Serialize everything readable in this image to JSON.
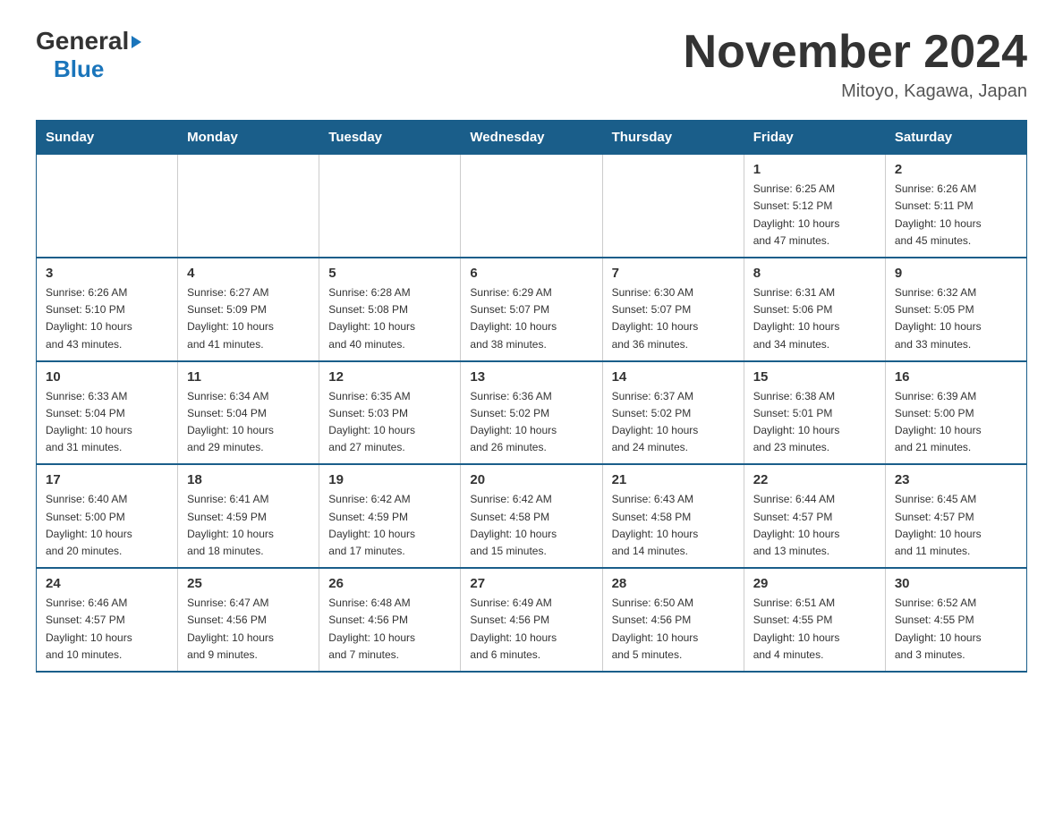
{
  "header": {
    "month_title": "November 2024",
    "location": "Mitoyo, Kagawa, Japan",
    "logo_general": "General",
    "logo_blue": "Blue"
  },
  "days_of_week": [
    "Sunday",
    "Monday",
    "Tuesday",
    "Wednesday",
    "Thursday",
    "Friday",
    "Saturday"
  ],
  "weeks": [
    {
      "cells": [
        {
          "day": "",
          "info": ""
        },
        {
          "day": "",
          "info": ""
        },
        {
          "day": "",
          "info": ""
        },
        {
          "day": "",
          "info": ""
        },
        {
          "day": "",
          "info": ""
        },
        {
          "day": "1",
          "info": "Sunrise: 6:25 AM\nSunset: 5:12 PM\nDaylight: 10 hours\nand 47 minutes."
        },
        {
          "day": "2",
          "info": "Sunrise: 6:26 AM\nSunset: 5:11 PM\nDaylight: 10 hours\nand 45 minutes."
        }
      ]
    },
    {
      "cells": [
        {
          "day": "3",
          "info": "Sunrise: 6:26 AM\nSunset: 5:10 PM\nDaylight: 10 hours\nand 43 minutes."
        },
        {
          "day": "4",
          "info": "Sunrise: 6:27 AM\nSunset: 5:09 PM\nDaylight: 10 hours\nand 41 minutes."
        },
        {
          "day": "5",
          "info": "Sunrise: 6:28 AM\nSunset: 5:08 PM\nDaylight: 10 hours\nand 40 minutes."
        },
        {
          "day": "6",
          "info": "Sunrise: 6:29 AM\nSunset: 5:07 PM\nDaylight: 10 hours\nand 38 minutes."
        },
        {
          "day": "7",
          "info": "Sunrise: 6:30 AM\nSunset: 5:07 PM\nDaylight: 10 hours\nand 36 minutes."
        },
        {
          "day": "8",
          "info": "Sunrise: 6:31 AM\nSunset: 5:06 PM\nDaylight: 10 hours\nand 34 minutes."
        },
        {
          "day": "9",
          "info": "Sunrise: 6:32 AM\nSunset: 5:05 PM\nDaylight: 10 hours\nand 33 minutes."
        }
      ]
    },
    {
      "cells": [
        {
          "day": "10",
          "info": "Sunrise: 6:33 AM\nSunset: 5:04 PM\nDaylight: 10 hours\nand 31 minutes."
        },
        {
          "day": "11",
          "info": "Sunrise: 6:34 AM\nSunset: 5:04 PM\nDaylight: 10 hours\nand 29 minutes."
        },
        {
          "day": "12",
          "info": "Sunrise: 6:35 AM\nSunset: 5:03 PM\nDaylight: 10 hours\nand 27 minutes."
        },
        {
          "day": "13",
          "info": "Sunrise: 6:36 AM\nSunset: 5:02 PM\nDaylight: 10 hours\nand 26 minutes."
        },
        {
          "day": "14",
          "info": "Sunrise: 6:37 AM\nSunset: 5:02 PM\nDaylight: 10 hours\nand 24 minutes."
        },
        {
          "day": "15",
          "info": "Sunrise: 6:38 AM\nSunset: 5:01 PM\nDaylight: 10 hours\nand 23 minutes."
        },
        {
          "day": "16",
          "info": "Sunrise: 6:39 AM\nSunset: 5:00 PM\nDaylight: 10 hours\nand 21 minutes."
        }
      ]
    },
    {
      "cells": [
        {
          "day": "17",
          "info": "Sunrise: 6:40 AM\nSunset: 5:00 PM\nDaylight: 10 hours\nand 20 minutes."
        },
        {
          "day": "18",
          "info": "Sunrise: 6:41 AM\nSunset: 4:59 PM\nDaylight: 10 hours\nand 18 minutes."
        },
        {
          "day": "19",
          "info": "Sunrise: 6:42 AM\nSunset: 4:59 PM\nDaylight: 10 hours\nand 17 minutes."
        },
        {
          "day": "20",
          "info": "Sunrise: 6:42 AM\nSunset: 4:58 PM\nDaylight: 10 hours\nand 15 minutes."
        },
        {
          "day": "21",
          "info": "Sunrise: 6:43 AM\nSunset: 4:58 PM\nDaylight: 10 hours\nand 14 minutes."
        },
        {
          "day": "22",
          "info": "Sunrise: 6:44 AM\nSunset: 4:57 PM\nDaylight: 10 hours\nand 13 minutes."
        },
        {
          "day": "23",
          "info": "Sunrise: 6:45 AM\nSunset: 4:57 PM\nDaylight: 10 hours\nand 11 minutes."
        }
      ]
    },
    {
      "cells": [
        {
          "day": "24",
          "info": "Sunrise: 6:46 AM\nSunset: 4:57 PM\nDaylight: 10 hours\nand 10 minutes."
        },
        {
          "day": "25",
          "info": "Sunrise: 6:47 AM\nSunset: 4:56 PM\nDaylight: 10 hours\nand 9 minutes."
        },
        {
          "day": "26",
          "info": "Sunrise: 6:48 AM\nSunset: 4:56 PM\nDaylight: 10 hours\nand 7 minutes."
        },
        {
          "day": "27",
          "info": "Sunrise: 6:49 AM\nSunset: 4:56 PM\nDaylight: 10 hours\nand 6 minutes."
        },
        {
          "day": "28",
          "info": "Sunrise: 6:50 AM\nSunset: 4:56 PM\nDaylight: 10 hours\nand 5 minutes."
        },
        {
          "day": "29",
          "info": "Sunrise: 6:51 AM\nSunset: 4:55 PM\nDaylight: 10 hours\nand 4 minutes."
        },
        {
          "day": "30",
          "info": "Sunrise: 6:52 AM\nSunset: 4:55 PM\nDaylight: 10 hours\nand 3 minutes."
        }
      ]
    }
  ]
}
